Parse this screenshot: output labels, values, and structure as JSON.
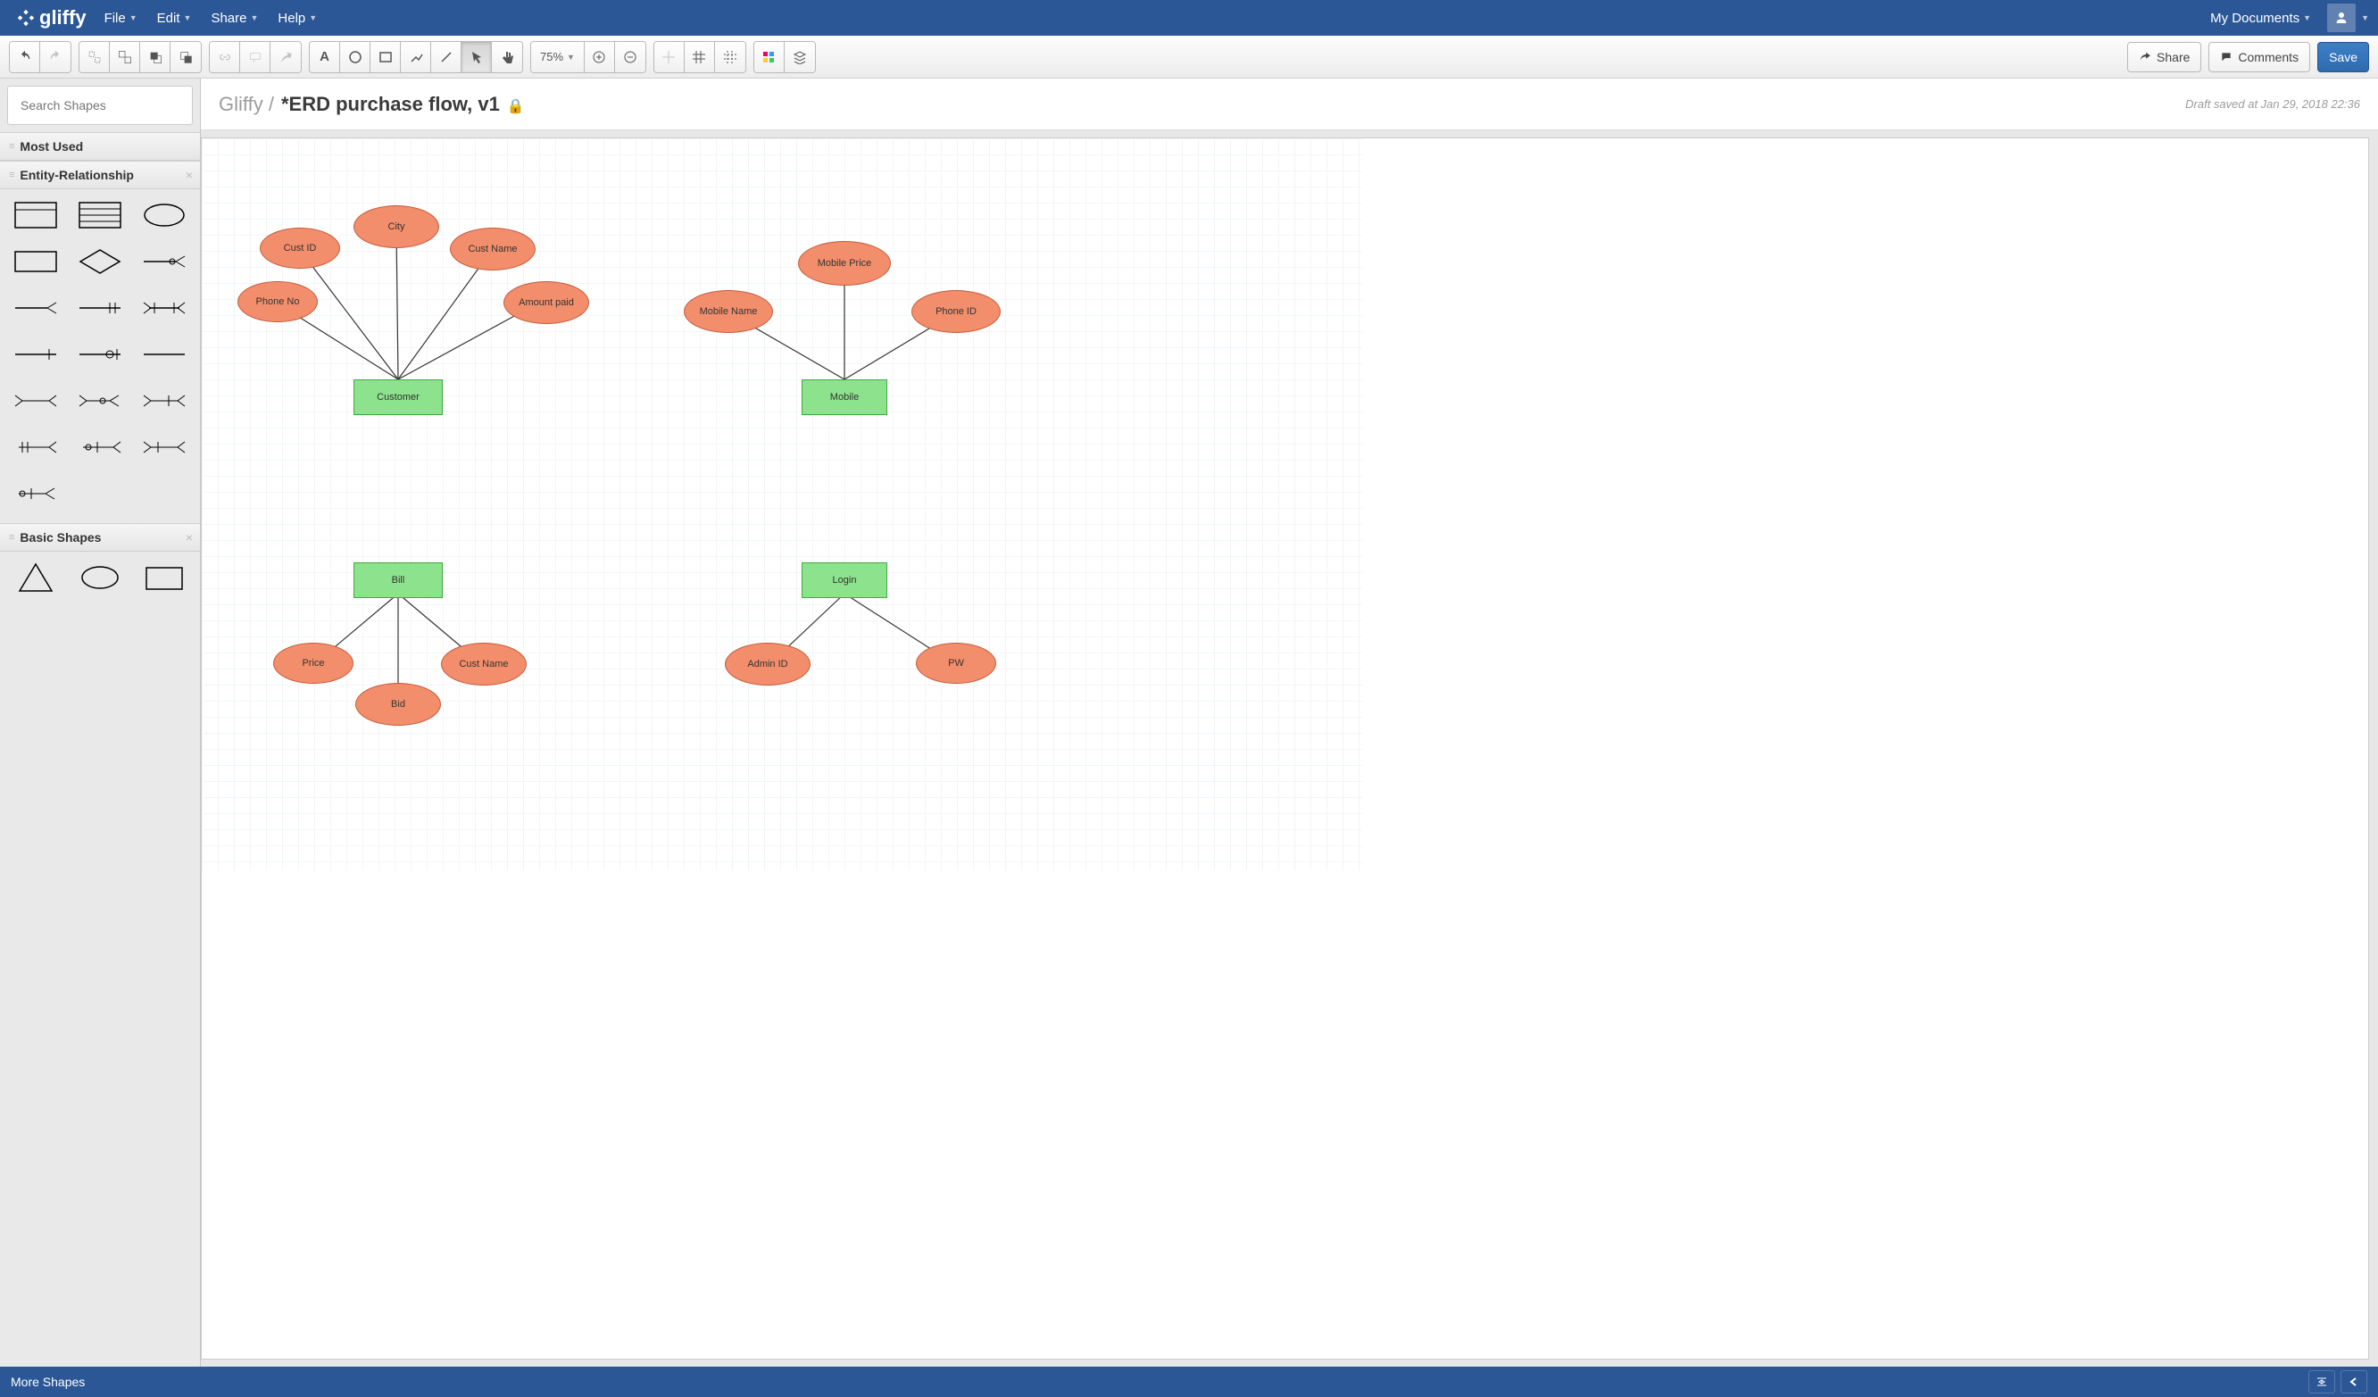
{
  "brand": "gliffy",
  "menu": {
    "file": "File",
    "edit": "Edit",
    "share": "Share",
    "help": "Help",
    "my_documents": "My Documents"
  },
  "toolbar": {
    "zoom_value": "75%",
    "share": "Share",
    "comments": "Comments",
    "save": "Save"
  },
  "search": {
    "placeholder": "Search Shapes"
  },
  "panels": {
    "most_used": "Most Used",
    "er": "Entity-Relationship",
    "basic": "Basic Shapes"
  },
  "footer": {
    "more_shapes": "More Shapes"
  },
  "doc": {
    "crumb": "Gliffy /",
    "name": "*ERD purchase flow, v1",
    "status": "Draft saved at Jan 29, 2018 22:36"
  },
  "diagram": {
    "entities": {
      "customer": "Customer",
      "mobile": "Mobile",
      "bill": "Bill",
      "login": "Login"
    },
    "attrs": {
      "cust_id": "Cust ID",
      "city": "City",
      "cust_name": "Cust Name",
      "phone_no": "Phone No",
      "amount_paid": "Amount paid",
      "mobile_name": "Mobile Name",
      "mobile_price": "Mobile Price",
      "phone_id": "Phone ID",
      "price": "Price",
      "bid": "Bid",
      "bill_cust_name": "Cust Name",
      "admin_id": "Admin ID",
      "pw": "PW"
    }
  }
}
